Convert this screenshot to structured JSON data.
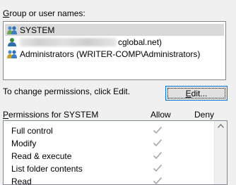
{
  "group_label": "Group or user names:",
  "users": [
    {
      "name": "SYSTEM",
      "icon": "users-group-icon",
      "selected": true
    },
    {
      "name": "cglobal.net)",
      "icon": "user-icon",
      "selected": false,
      "blurred_prefix": true
    },
    {
      "name": "Administrators (WRITER-COMP\\Administrators)",
      "icon": "users-group-icon",
      "selected": false
    }
  ],
  "change_text": "To change permissions, click Edit.",
  "edit_button": "Edit...",
  "permissions_label": "Permissions for SYSTEM",
  "allow_label": "Allow",
  "deny_label": "Deny",
  "permissions": [
    {
      "name": "Full control",
      "allow": true,
      "deny": false
    },
    {
      "name": "Modify",
      "allow": true,
      "deny": false
    },
    {
      "name": "Read & execute",
      "allow": true,
      "deny": false
    },
    {
      "name": "List folder contents",
      "allow": true,
      "deny": false
    },
    {
      "name": "Read",
      "allow": true,
      "deny": false
    }
  ]
}
